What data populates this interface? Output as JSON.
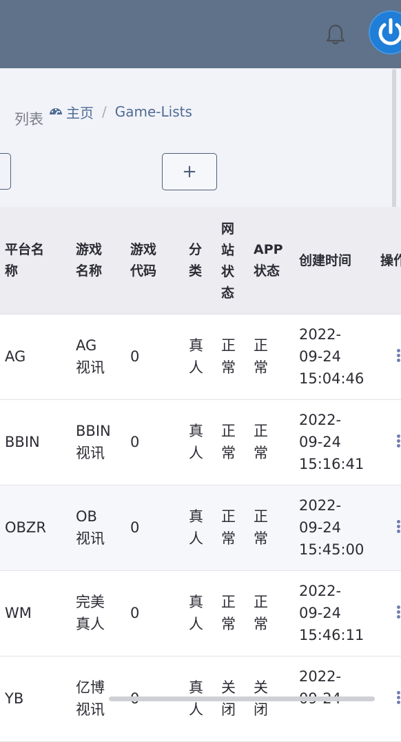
{
  "header": {
    "bell_icon": "bell-icon",
    "avatar_icon": "power-icon"
  },
  "page": {
    "title": "列表"
  },
  "breadcrumb": {
    "home_icon": "dashboard-gauge-icon",
    "home": "主页",
    "separator": "/",
    "current": "Game-Lists"
  },
  "toolbar": {
    "add_label": "+"
  },
  "table": {
    "headers": {
      "platform": [
        "平台名",
        "称"
      ],
      "game_name": [
        "游戏",
        "名称"
      ],
      "game_code": [
        "游戏",
        "代码"
      ],
      "category": [
        "分",
        "类"
      ],
      "web_status": [
        "网",
        "站",
        "状",
        "态"
      ],
      "app_status": [
        "APP",
        "状态"
      ],
      "created": "创建时间",
      "actions": "操作"
    },
    "rows": [
      {
        "platform": "AG",
        "name": [
          "AG",
          "视讯"
        ],
        "code": "0",
        "category": [
          "真",
          "人"
        ],
        "web": [
          "正",
          "常"
        ],
        "app": [
          "正",
          "常"
        ],
        "created": [
          "2022-",
          "09-24",
          "15:04:46"
        ]
      },
      {
        "platform": "BBIN",
        "name": [
          "BBIN",
          "视讯"
        ],
        "code": "0",
        "category": [
          "真",
          "人"
        ],
        "web": [
          "正",
          "常"
        ],
        "app": [
          "正",
          "常"
        ],
        "created": [
          "2022-",
          "09-24",
          "15:16:41"
        ]
      },
      {
        "platform": "OBZR",
        "name": [
          "OB",
          "视讯"
        ],
        "code": "0",
        "category": [
          "真",
          "人"
        ],
        "web": [
          "正",
          "常"
        ],
        "app": [
          "正",
          "常"
        ],
        "created": [
          "2022-",
          "09-24",
          "15:45:00"
        ]
      },
      {
        "platform": "WM",
        "name": [
          "完美",
          "真人"
        ],
        "code": "0",
        "category": [
          "真",
          "人"
        ],
        "web": [
          "正",
          "常"
        ],
        "app": [
          "正",
          "常"
        ],
        "created": [
          "2022-",
          "09-24",
          "15:46:11"
        ]
      },
      {
        "platform": "YB",
        "name": [
          "亿博",
          "视讯"
        ],
        "code": "0",
        "category": [
          "真",
          "人"
        ],
        "web": [
          "关",
          "闭"
        ],
        "app": [
          "关",
          "闭"
        ],
        "created": [
          "2022-",
          "09-24",
          ""
        ]
      }
    ]
  },
  "colors": {
    "topbar": "#5f7289",
    "accent": "#4f6b94",
    "avatar": "#1e7ed8"
  }
}
